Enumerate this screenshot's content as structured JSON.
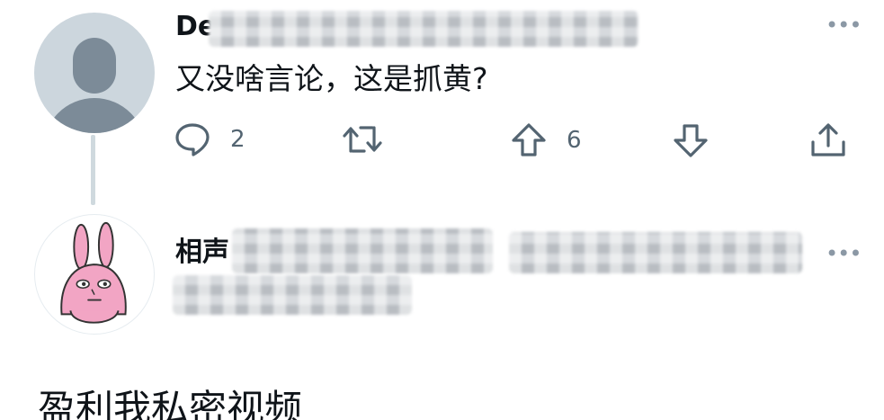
{
  "tweet1": {
    "author_visible": "De",
    "text": "又没啥言论，这是抓黄?",
    "reply_count": "2",
    "upvote_count": "6"
  },
  "tweet2": {
    "author_visible": "相声"
  },
  "bottom": {
    "text": "盈利我私密视频"
  },
  "icons": {
    "reply": "comment-bubble-icon",
    "retweet": "retweet-icon",
    "upvote": "arrow-up-icon",
    "downvote": "arrow-down-icon",
    "share": "share-icon",
    "more": "more-dots-icon"
  },
  "colors": {
    "icon_gray": "#536471",
    "line_gray": "#cfd9de",
    "text": "#0f1419",
    "bunny_pink": "#f2a5c4"
  }
}
